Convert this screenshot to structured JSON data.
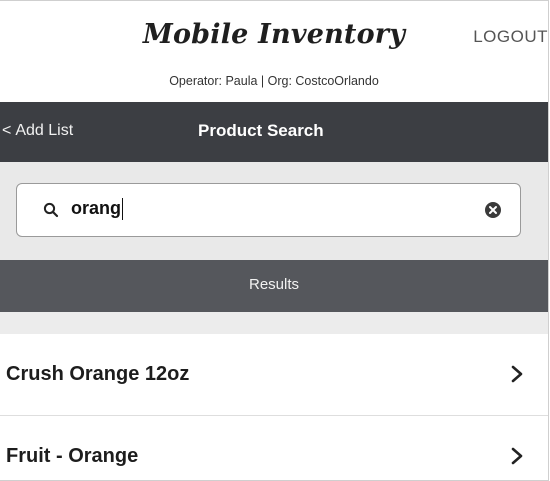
{
  "header": {
    "app_title": "Mobile Inventory",
    "logout_label": "LOGOUT",
    "operator_line": "Operator: Paula | Org: CostcoOrlando"
  },
  "navbar": {
    "back_label": "Add List",
    "title": "Product Search"
  },
  "search": {
    "value": "orang",
    "placeholder": ""
  },
  "results": {
    "label": "Results",
    "items": [
      {
        "label": "Crush Orange 12oz"
      },
      {
        "label": "Fruit - Orange"
      }
    ]
  },
  "colors": {
    "navbar_bg": "#3c3e43",
    "results_bar_bg": "#55575c",
    "search_area_bg": "#e9e9e9"
  },
  "icons": {
    "back": "chevron-left-icon",
    "search": "search-icon",
    "clear": "clear-icon",
    "row": "chevron-right-icon"
  }
}
